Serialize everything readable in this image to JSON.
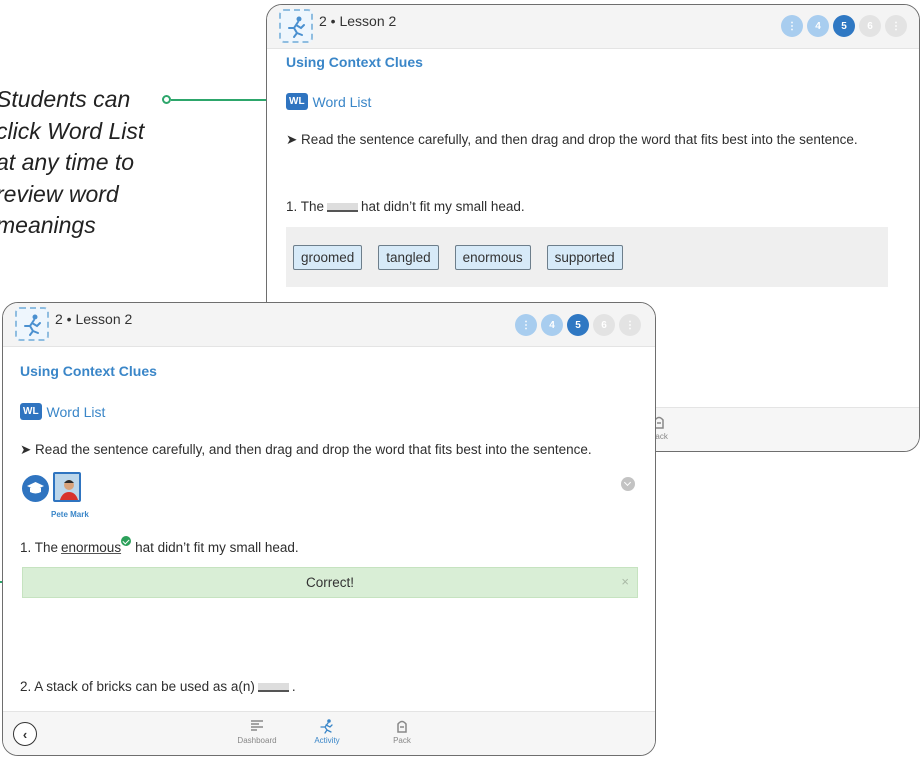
{
  "callout": {
    "lines": [
      "Students can",
      "click Word List",
      "at any time to",
      "review word",
      "meanings"
    ]
  },
  "back_screen": {
    "lesson_title": "2 • Lesson 2",
    "steps": [
      "",
      "4",
      "5",
      "6",
      ""
    ],
    "section_title": "Using Context Clues",
    "word_list_badge": "WL",
    "word_list_label": "Word List",
    "instruction": "➤ Read the sentence carefully, and then drag and drop the word that fits best into the sentence.",
    "question": {
      "prefix": "1. The",
      "suffix": "hat didn’t fit my small head."
    },
    "word_bank": [
      "groomed",
      "tangled",
      "enormous",
      "supported"
    ],
    "nav_pack": "Pack"
  },
  "front_screen": {
    "lesson_title": "2 • Lesson 2",
    "steps": [
      "",
      "4",
      "5",
      "6",
      ""
    ],
    "section_title": "Using Context Clues",
    "word_list_badge": "WL",
    "word_list_label": "Word List",
    "instruction": "➤ Read the sentence carefully, and then drag and drop the word that fits best into the sentence.",
    "student_name": "Pete Mark",
    "question1": {
      "prefix": "1. The",
      "answer": "enormous",
      "suffix": "hat didn’t fit my small head."
    },
    "feedback": "Correct!",
    "feedback_close": "×",
    "question2": {
      "prefix": "2. A stack of bricks can be used as a(n)",
      "suffix": "."
    },
    "nav": {
      "dashboard": "Dashboard",
      "activity": "Activity",
      "pack": "Pack"
    },
    "back_symbol": "‹"
  },
  "colors": {
    "accent": "#3a86c8",
    "active_step": "#2f78c3",
    "success": "#2ca05a",
    "callout_line": "#2da66b"
  }
}
